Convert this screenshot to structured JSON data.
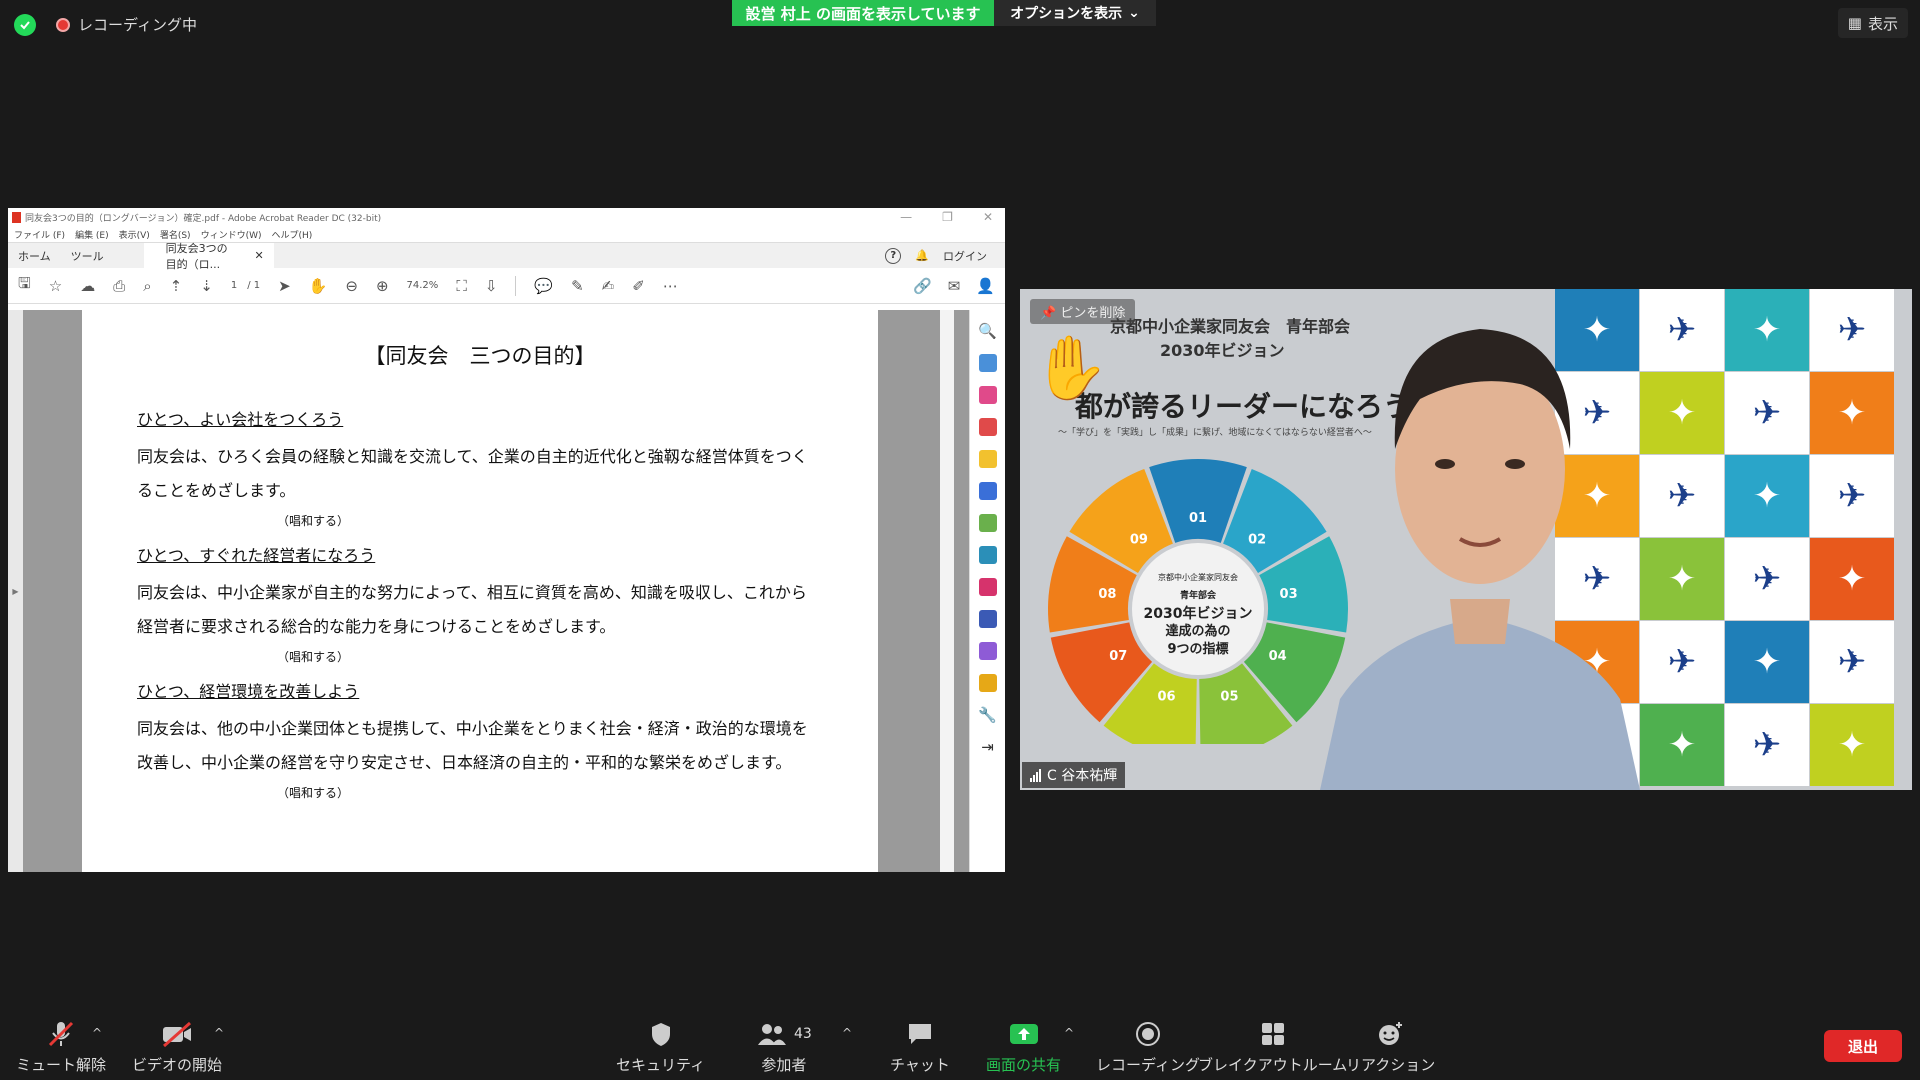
{
  "top": {
    "recording": "レコーディング中",
    "sharing": "設営 村上 の画面を表示しています",
    "options": "オプションを表示",
    "view": "表示"
  },
  "acrobat": {
    "title": "同友会3つの目的（ロングバージョン）確定.pdf - Adobe Acrobat Reader DC (32-bit)",
    "menu": [
      "ファイル (F)",
      "編集 (E)",
      "表示(V)",
      "署名(S)",
      "ウィンドウ(W)",
      "ヘルプ(H)"
    ],
    "tab_home": "ホーム",
    "tab_tools": "ツール",
    "doc_tab": "同友会3つの目的（ロ...",
    "login": "ログイン",
    "page_current": "1",
    "page_total": "/ 1",
    "zoom": "74.2%"
  },
  "document": {
    "title": "【同友会　三つの目的】",
    "sections": [
      {
        "heading": "ひとつ、よい会社をつくろう",
        "body": "同友会は、ひろく会員の経験と知識を交流して、企業の自主的近代化と強靱な経営体質をつくることをめざします。",
        "chant": "（唱和する）"
      },
      {
        "heading": "ひとつ、すぐれた経営者になろう",
        "body": "同友会は、中小企業家が自主的な努力によって、相互に資質を高め、知識を吸収し、これから経営者に要求される総合的な能力を身につけることをめざします。",
        "chant": "（唱和する）"
      },
      {
        "heading": "ひとつ、経営環境を改善しよう",
        "body": "同友会は、他の中小企業団体とも提携して、中小企業をとりまく社会・経済・政治的な環境を改善し、中小企業の経営を守り安定させ、日本経済の自主的・平和的な繁栄をめざします。",
        "chant": "（唱和する）"
      }
    ]
  },
  "video": {
    "pin_label": "ピンを削除",
    "participant_name": "C 谷本祐輝",
    "slide_org": "京都中小企業家同友会　青年部会",
    "slide_vision": "2030年ビジョン",
    "slide_headline": "都が誇るリーダーになろう",
    "slide_tagline": "〜「学び」を「実践」し「成果」に繋げ、地域になくてはならない経営者へ〜",
    "wheel_center": [
      "京都中小企業家同友会",
      "青年部会",
      "2030年ビジョン",
      "達成の為の",
      "9つの指標"
    ],
    "wheel_numbers": [
      "01",
      "02",
      "03",
      "04",
      "05",
      "06",
      "07",
      "08",
      "09"
    ],
    "wheel_colors": [
      "#1f7fb8",
      "#2aa5c9",
      "#2bb0b8",
      "#4fb04f",
      "#8ac23a",
      "#c0d020",
      "#e8591c",
      "#f07e19",
      "#f5a21a"
    ]
  },
  "toolbar": {
    "mute": "ミュート解除",
    "video": "ビデオの開始",
    "security": "セキュリティ",
    "participants": "参加者",
    "participant_count": "43",
    "chat": "チャット",
    "share": "画面の共有",
    "record": "レコーディング",
    "breakout": "ブレイクアウトルーム",
    "reactions": "リアクション",
    "leave": "退出"
  }
}
